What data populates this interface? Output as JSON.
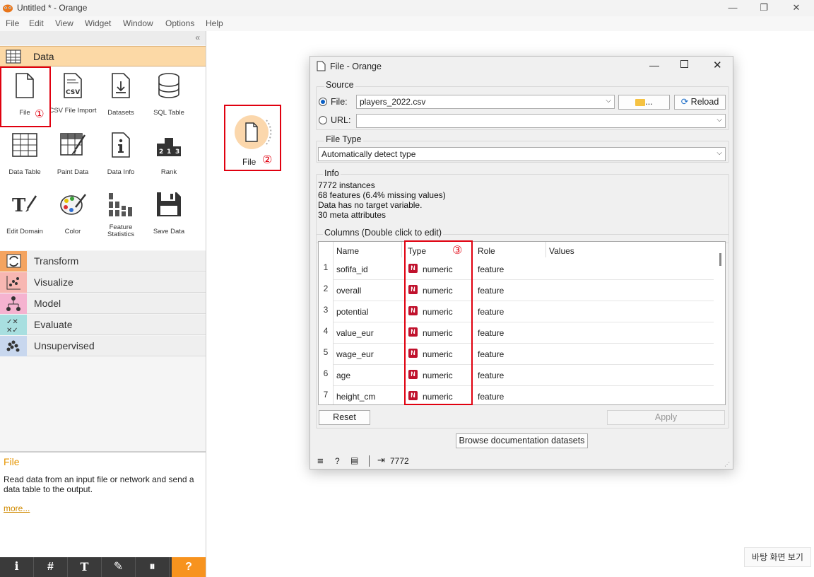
{
  "window": {
    "title": "Untitled * - Orange",
    "controls": {
      "minimize": "—",
      "maximize": "❐",
      "close": "✕"
    }
  },
  "menubar": [
    "File",
    "Edit",
    "View",
    "Widget",
    "Window",
    "Options",
    "Help"
  ],
  "sidebar": {
    "collapse": "«",
    "active_category": "Data",
    "widgets": [
      {
        "label": "File",
        "icon": "file-icon",
        "marker": "①"
      },
      {
        "label": "CSV File Import",
        "icon": "csv-icon"
      },
      {
        "label": "Datasets",
        "icon": "datasets-icon"
      },
      {
        "label": "SQL Table",
        "icon": "database-icon"
      },
      {
        "label": "Data Table",
        "icon": "table-icon"
      },
      {
        "label": "Paint Data",
        "icon": "paint-icon"
      },
      {
        "label": "Data Info",
        "icon": "info-icon"
      },
      {
        "label": "Rank",
        "icon": "rank-icon"
      },
      {
        "label": "Edit Domain",
        "icon": "edit-domain-icon"
      },
      {
        "label": "Color",
        "icon": "palette-icon"
      },
      {
        "label": "Feature Statistics",
        "icon": "stats-icon"
      },
      {
        "label": "Save Data",
        "icon": "save-icon"
      }
    ],
    "categories": [
      {
        "label": "Transform",
        "color": "#f4a460"
      },
      {
        "label": "Visualize",
        "color": "#f7b7b2"
      },
      {
        "label": "Model",
        "color": "#f5b3d0"
      },
      {
        "label": "Evaluate",
        "color": "#a8dfe0"
      },
      {
        "label": "Unsupervised",
        "color": "#c8d7ee"
      }
    ],
    "description": {
      "title": "File",
      "text": "Read data from an input file or network and send a data table to the output.",
      "more": "more..."
    },
    "toolbar": [
      "ℹ",
      "#",
      "T",
      "✎",
      "⏸",
      "?"
    ]
  },
  "canvas": {
    "node_label": "File",
    "marker": "②"
  },
  "dialog": {
    "title": "File - Orange",
    "source": {
      "group_label": "Source",
      "file_label": "File:",
      "file_value": "players_2022.csv",
      "browse_label": "...",
      "reload_label": "Reload",
      "url_label": "URL:",
      "url_value": ""
    },
    "file_type": {
      "group_label": "File Type",
      "value": "Automatically detect type"
    },
    "info": {
      "group_label": "Info",
      "lines": [
        "7772 instances",
        "68 features (6.4% missing values)",
        "Data has no target variable.",
        "30 meta attributes"
      ]
    },
    "columns": {
      "group_label": "Columns (Double click to edit)",
      "headers": [
        "Name",
        "Type",
        "Role",
        "Values"
      ],
      "type_marker": "③",
      "rows": [
        {
          "idx": "1",
          "name": "sofifa_id",
          "type": "numeric",
          "role": "feature"
        },
        {
          "idx": "2",
          "name": "overall",
          "type": "numeric",
          "role": "feature"
        },
        {
          "idx": "3",
          "name": "potential",
          "type": "numeric",
          "role": "feature"
        },
        {
          "idx": "4",
          "name": "value_eur",
          "type": "numeric",
          "role": "feature"
        },
        {
          "idx": "5",
          "name": "wage_eur",
          "type": "numeric",
          "role": "feature"
        },
        {
          "idx": "6",
          "name": "age",
          "type": "numeric",
          "role": "feature"
        },
        {
          "idx": "7",
          "name": "height_cm",
          "type": "numeric",
          "role": "feature"
        }
      ],
      "type_badge": "N"
    },
    "reset_label": "Reset",
    "apply_label": "Apply",
    "browse_docs_label": "Browse documentation datasets",
    "status_output": "7772"
  },
  "taskbar_tip": "바탕 화면 보기"
}
